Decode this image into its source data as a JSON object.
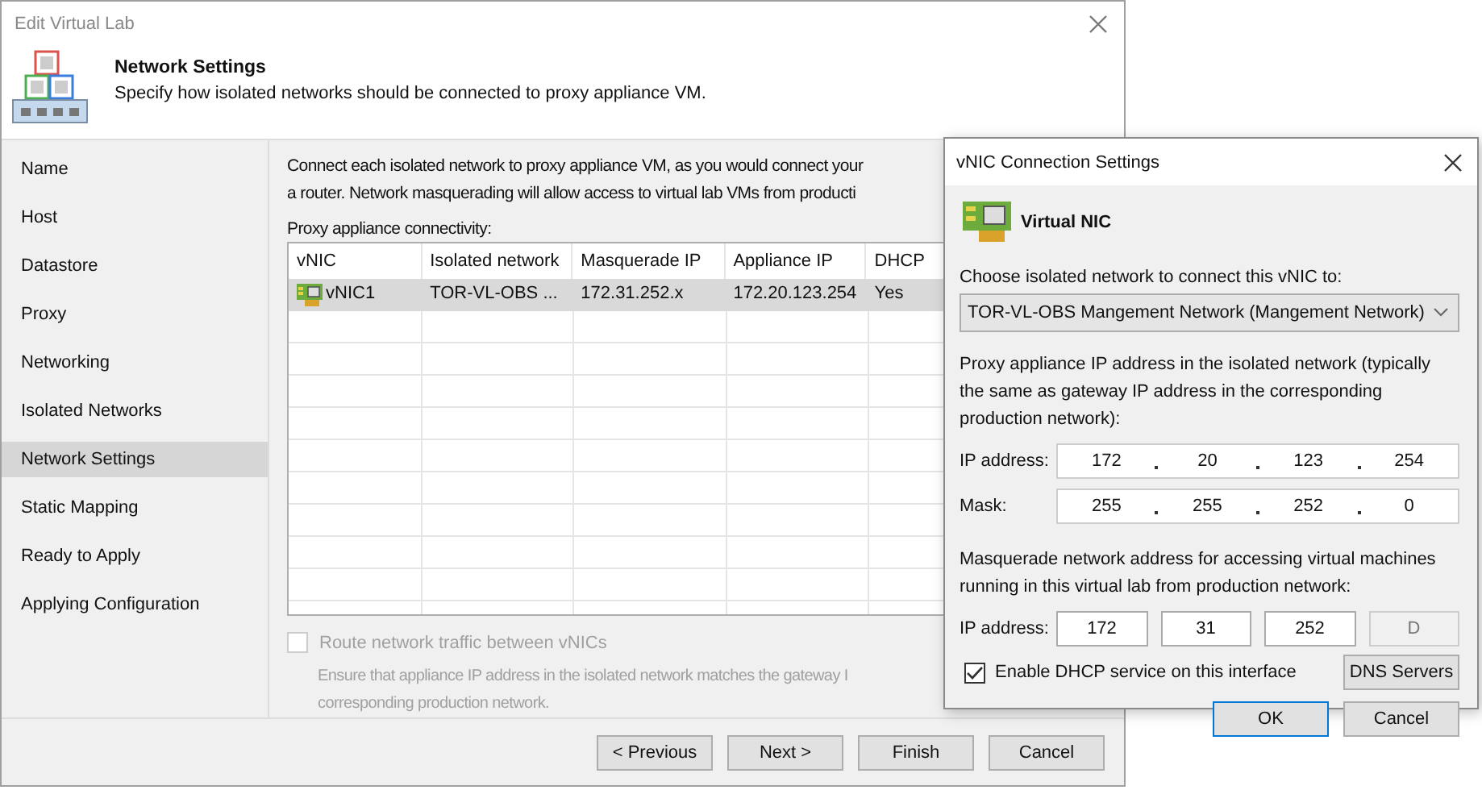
{
  "window": {
    "title": "Edit Virtual Lab"
  },
  "header": {
    "title": "Network Settings",
    "subtitle": "Specify how isolated networks should be connected to proxy appliance VM."
  },
  "sidebar": {
    "items": [
      {
        "label": "Name",
        "selected": false
      },
      {
        "label": "Host",
        "selected": false
      },
      {
        "label": "Datastore",
        "selected": false
      },
      {
        "label": "Proxy",
        "selected": false
      },
      {
        "label": "Networking",
        "selected": false
      },
      {
        "label": "Isolated Networks",
        "selected": false
      },
      {
        "label": "Network Settings",
        "selected": true
      },
      {
        "label": "Static Mapping",
        "selected": false
      },
      {
        "label": "Ready to Apply",
        "selected": false
      },
      {
        "label": "Applying Configuration",
        "selected": false
      }
    ]
  },
  "content": {
    "description_lines": [
      "Connect each isolated network to proxy appliance VM, as you would connect your",
      "a router. Network masquerading will allow access to virtual lab VMs from producti"
    ],
    "table_label": "Proxy appliance connectivity:",
    "table": {
      "columns": [
        "vNIC",
        "Isolated network",
        "Masquerade IP",
        "Appliance IP",
        "DHCP"
      ],
      "rows": [
        {
          "cells": [
            "vNIC1",
            "TOR-VL-OBS ...",
            "172.31.252.x",
            "172.20.123.254",
            "Yes"
          ],
          "selected": true
        }
      ]
    },
    "route_option": {
      "label": "Route network traffic between vNICs",
      "checked": false,
      "disabled": true
    },
    "note_lines": [
      "Ensure that appliance IP address in the isolated network matches the gateway I",
      "corresponding production network."
    ]
  },
  "buttons": [
    {
      "label": "< Previous"
    },
    {
      "label": "Next >"
    },
    {
      "label": "Finish"
    },
    {
      "label": "Cancel"
    }
  ],
  "dialog": {
    "title": "vNIC Connection Settings",
    "heading": "Virtual NIC",
    "network_label": "Choose isolated network to connect this vNIC to:",
    "network_value": "TOR-VL-OBS Mangement Network (Mangement Network)",
    "proxy_label": "Proxy appliance IP address in the isolated network (typically the same as gateway IP address in the corresponding production network):",
    "ip_address": {
      "label": "IP address:",
      "octets": [
        "172",
        "20",
        "123",
        "254"
      ]
    },
    "mask": {
      "label": "Mask:",
      "octets": [
        "255",
        "255",
        "252",
        "0"
      ]
    },
    "masquerade_label": "Masquerade network address for accessing virtual machines running in this virtual lab from production network:",
    "masquerade_ip": {
      "label": "IP address:",
      "octets": [
        {
          "value": "172",
          "disabled": false
        },
        {
          "value": "31",
          "disabled": false
        },
        {
          "value": "252",
          "disabled": false
        },
        {
          "value": "D",
          "disabled": true
        }
      ]
    },
    "dhcp": {
      "label": "Enable DHCP service on this interface",
      "checked": true
    },
    "dns_button": "DNS Servers",
    "buttons": [
      {
        "label": "OK",
        "default": true
      },
      {
        "label": "Cancel",
        "default": false
      }
    ]
  }
}
